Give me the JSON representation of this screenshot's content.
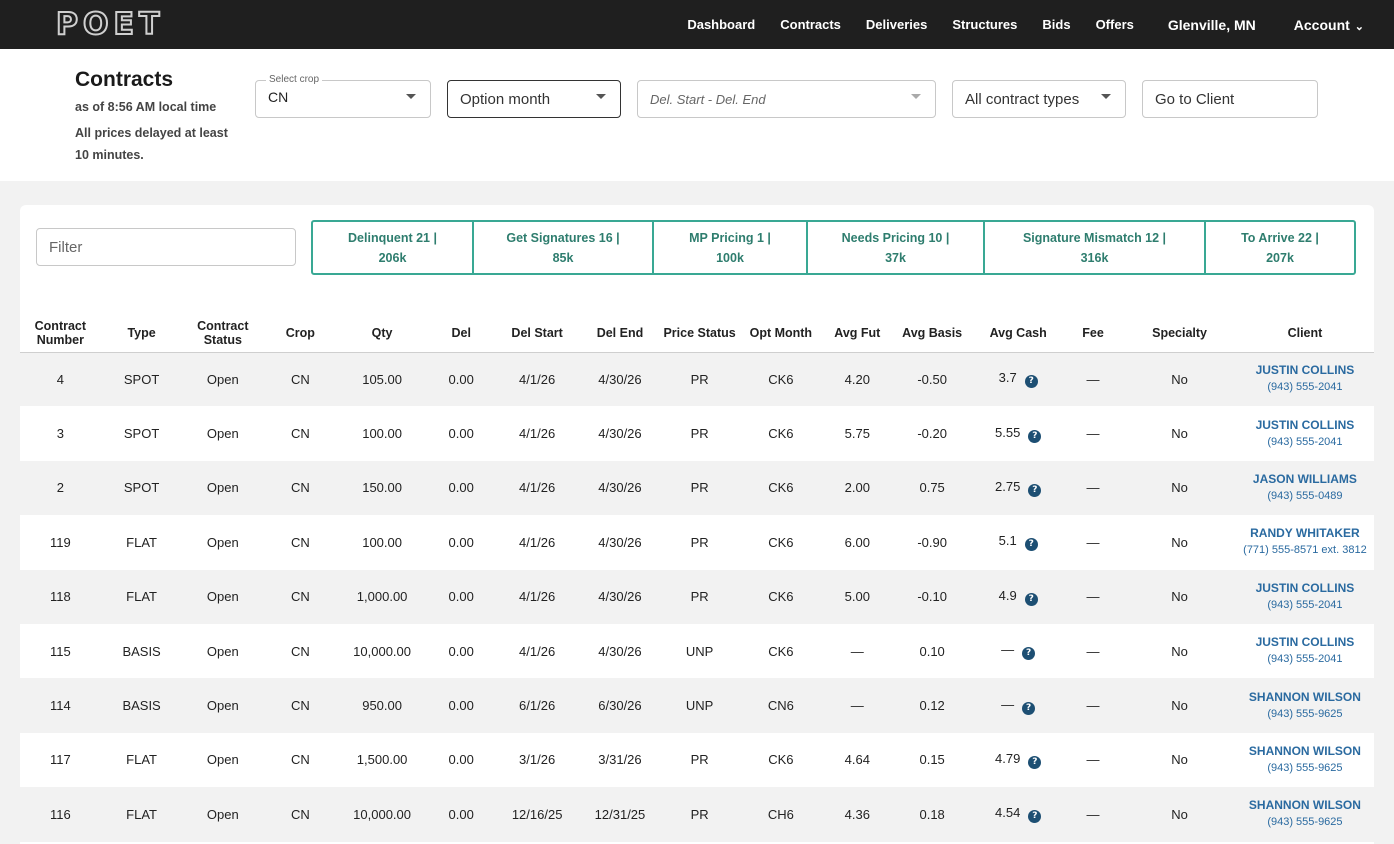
{
  "logo": "POET",
  "nav": {
    "items": [
      "Dashboard",
      "Contracts",
      "Deliveries",
      "Structures",
      "Bids",
      "Offers"
    ],
    "location": "Glenville, MN",
    "account": "Account"
  },
  "header": {
    "title": "Contracts",
    "as_of": "as of 8:56 AM local time",
    "delay_note": "All prices delayed at least 10 minutes."
  },
  "filters": {
    "crop_legend": "Select crop",
    "crop_value": "CN",
    "option_month": "Option month",
    "date_range": "Del. Start - Del. End",
    "contract_types": "All contract types",
    "client_placeholder": "Go to Client",
    "filter_placeholder": "Filter"
  },
  "chips": [
    {
      "label": "Delinquent 21 |",
      "amount": "206k"
    },
    {
      "label": "Get Signatures 16 |",
      "amount": "85k"
    },
    {
      "label": "MP Pricing 1 |",
      "amount": "100k"
    },
    {
      "label": "Needs Pricing 10 |",
      "amount": "37k"
    },
    {
      "label": "Signature Mismatch 12 |",
      "amount": "316k"
    },
    {
      "label": "To Arrive 22 |",
      "amount": "207k"
    }
  ],
  "columns": [
    "Contract Number",
    "Type",
    "Contract Status",
    "Crop",
    "Qty",
    "Del",
    "Del Start",
    "Del End",
    "Price Status",
    "Opt Month",
    "Avg Fut",
    "Avg Basis",
    "Avg Cash",
    "Fee",
    "Specialty",
    "Client"
  ],
  "rows": [
    {
      "num": "4",
      "type": "SPOT",
      "status": "Open",
      "crop": "CN",
      "qty": "105.00",
      "del": "0.00",
      "start": "4/1/26",
      "end": "4/30/26",
      "price_status": "PR",
      "opt": "CK6",
      "fut": "4.20",
      "basis": "-0.50",
      "cash": "3.7",
      "fee": "—",
      "specialty": "No",
      "client": "JUSTIN COLLINS",
      "phone": "(943) 555-2041"
    },
    {
      "num": "3",
      "type": "SPOT",
      "status": "Open",
      "crop": "CN",
      "qty": "100.00",
      "del": "0.00",
      "start": "4/1/26",
      "end": "4/30/26",
      "price_status": "PR",
      "opt": "CK6",
      "fut": "5.75",
      "basis": "-0.20",
      "cash": "5.55",
      "fee": "—",
      "specialty": "No",
      "client": "JUSTIN COLLINS",
      "phone": "(943) 555-2041"
    },
    {
      "num": "2",
      "type": "SPOT",
      "status": "Open",
      "crop": "CN",
      "qty": "150.00",
      "del": "0.00",
      "start": "4/1/26",
      "end": "4/30/26",
      "price_status": "PR",
      "opt": "CK6",
      "fut": "2.00",
      "basis": "0.75",
      "cash": "2.75",
      "fee": "—",
      "specialty": "No",
      "client": "JASON WILLIAMS",
      "phone": "(943) 555-0489"
    },
    {
      "num": "119",
      "type": "FLAT",
      "status": "Open",
      "crop": "CN",
      "qty": "100.00",
      "del": "0.00",
      "start": "4/1/26",
      "end": "4/30/26",
      "price_status": "PR",
      "opt": "CK6",
      "fut": "6.00",
      "basis": "-0.90",
      "cash": "5.1",
      "fee": "—",
      "specialty": "No",
      "client": "RANDY WHITAKER",
      "phone": "(771) 555-8571 ext. 3812"
    },
    {
      "num": "118",
      "type": "FLAT",
      "status": "Open",
      "crop": "CN",
      "qty": "1,000.00",
      "del": "0.00",
      "start": "4/1/26",
      "end": "4/30/26",
      "price_status": "PR",
      "opt": "CK6",
      "fut": "5.00",
      "basis": "-0.10",
      "cash": "4.9",
      "fee": "—",
      "specialty": "No",
      "client": "JUSTIN COLLINS",
      "phone": "(943) 555-2041"
    },
    {
      "num": "115",
      "type": "BASIS",
      "status": "Open",
      "crop": "CN",
      "qty": "10,000.00",
      "del": "0.00",
      "start": "4/1/26",
      "end": "4/30/26",
      "price_status": "UNP",
      "opt": "CK6",
      "fut": "—",
      "basis": "0.10",
      "cash": "—",
      "fee": "—",
      "specialty": "No",
      "client": "JUSTIN COLLINS",
      "phone": "(943) 555-2041"
    },
    {
      "num": "114",
      "type": "BASIS",
      "status": "Open",
      "crop": "CN",
      "qty": "950.00",
      "del": "0.00",
      "start": "6/1/26",
      "end": "6/30/26",
      "price_status": "UNP",
      "opt": "CN6",
      "fut": "—",
      "basis": "0.12",
      "cash": "—",
      "fee": "—",
      "specialty": "No",
      "client": "SHANNON WILSON",
      "phone": "(943) 555-9625"
    },
    {
      "num": "117",
      "type": "FLAT",
      "status": "Open",
      "crop": "CN",
      "qty": "1,500.00",
      "del": "0.00",
      "start": "3/1/26",
      "end": "3/31/26",
      "price_status": "PR",
      "opt": "CK6",
      "fut": "4.64",
      "basis": "0.15",
      "cash": "4.79",
      "fee": "—",
      "specialty": "No",
      "client": "SHANNON WILSON",
      "phone": "(943) 555-9625"
    },
    {
      "num": "116",
      "type": "FLAT",
      "status": "Open",
      "crop": "CN",
      "qty": "10,000.00",
      "del": "0.00",
      "start": "12/16/25",
      "end": "12/31/25",
      "price_status": "PR",
      "opt": "CH6",
      "fut": "4.36",
      "basis": "0.18",
      "cash": "4.54",
      "fee": "—",
      "specialty": "No",
      "client": "SHANNON WILSON",
      "phone": "(943) 555-9625"
    }
  ],
  "colors": {
    "nav_bg": "#1f1f1f",
    "accent": "#39a894",
    "link": "#2a6aa0",
    "help_icon": "#1d4f73"
  }
}
